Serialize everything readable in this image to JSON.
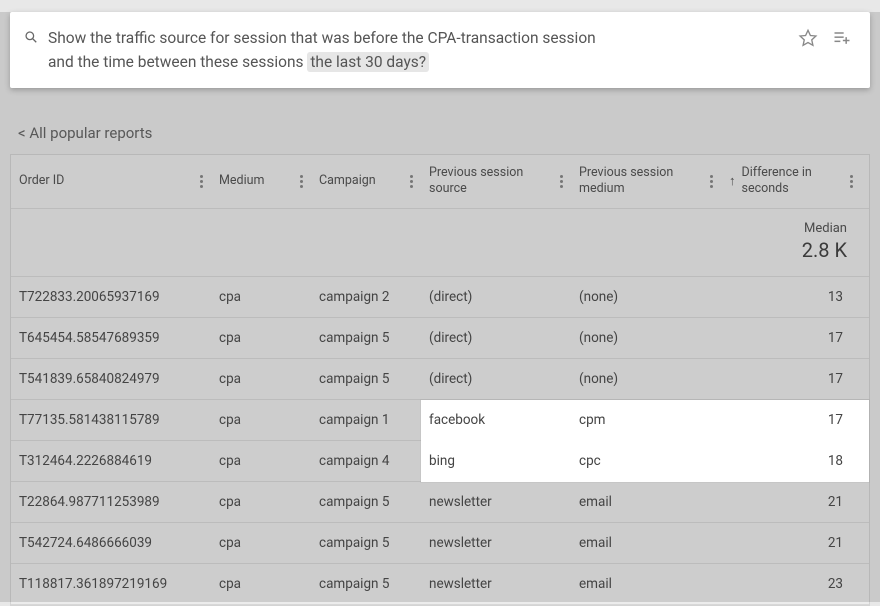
{
  "search": {
    "query_line1": "Show the traffic source for session that was before the CPA-transaction session",
    "query_line2_prefix": "and the time between these sessions ",
    "query_line2_pill": "the last 30 days?"
  },
  "breadcrumb": "< All popular reports",
  "columns": {
    "c0": "Order ID",
    "c1": "Medium",
    "c2": "Campaign",
    "c3": "Previous session source",
    "c4": "Previous session medium",
    "c5": "Difference in seconds"
  },
  "summary": {
    "label": "Median",
    "value": "2.8 K"
  },
  "rows": [
    {
      "order": "T722833.20065937169",
      "medium": "cpa",
      "campaign": "campaign 2",
      "psource": "(direct)",
      "pmedium": "(none)",
      "diff": "13"
    },
    {
      "order": "T645454.58547689359",
      "medium": "cpa",
      "campaign": "campaign 5",
      "psource": "(direct)",
      "pmedium": "(none)",
      "diff": "17"
    },
    {
      "order": "T541839.65840824979",
      "medium": "cpa",
      "campaign": "campaign 5",
      "psource": "(direct)",
      "pmedium": "(none)",
      "diff": "17"
    },
    {
      "order": "T77135.581438115789",
      "medium": "cpa",
      "campaign": "campaign 1",
      "psource": "facebook",
      "pmedium": "cpm",
      "diff": "17"
    },
    {
      "order": "T312464.2226884619",
      "medium": "cpa",
      "campaign": "campaign 4",
      "psource": "bing",
      "pmedium": "cpc",
      "diff": "18"
    },
    {
      "order": "T22864.987711253989",
      "medium": "cpa",
      "campaign": "campaign 5",
      "psource": "newsletter",
      "pmedium": "email",
      "diff": "21"
    },
    {
      "order": "T542724.6486666039",
      "medium": "cpa",
      "campaign": "campaign 5",
      "psource": "newsletter",
      "pmedium": "email",
      "diff": "21"
    },
    {
      "order": "T118817.361897219169",
      "medium": "cpa",
      "campaign": "campaign 5",
      "psource": "newsletter",
      "pmedium": "email",
      "diff": "23"
    }
  ],
  "highlight_rows": [
    3,
    4
  ]
}
